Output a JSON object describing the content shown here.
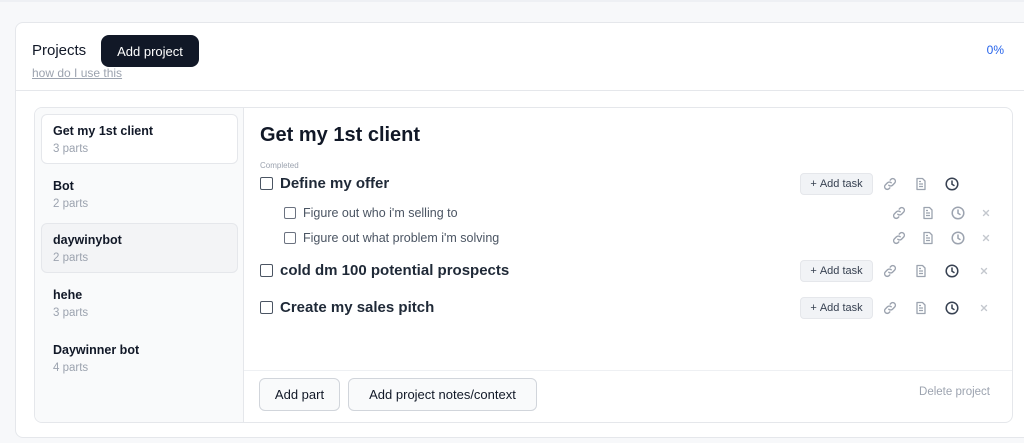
{
  "header": {
    "title": "Projects",
    "add_project_label": "Add project",
    "howto_link": "how do I use this",
    "progress_percent": "0%"
  },
  "sidebar": {
    "items": [
      {
        "name": "Get my 1st client",
        "parts": "3 parts",
        "active": true
      },
      {
        "name": "Bot",
        "parts": "2 parts"
      },
      {
        "name": "daywinybot",
        "parts": "2 parts",
        "hover": true
      },
      {
        "name": "hehe",
        "parts": "3 parts"
      },
      {
        "name": "Daywinner bot",
        "parts": "4 parts"
      }
    ]
  },
  "project": {
    "title": "Get my 1st client",
    "completed_label": "Completed",
    "add_task_label": "Add task",
    "parts": [
      {
        "label": "Define my offer",
        "tasks": [
          {
            "label": "Figure out who i'm selling to"
          },
          {
            "label": "Figure out what problem i'm solving"
          }
        ]
      },
      {
        "label": "cold dm 100 potential prospects",
        "tasks": []
      },
      {
        "label": "Create my sales pitch",
        "tasks": []
      }
    ]
  },
  "footer": {
    "add_part_label": "Add part",
    "add_notes_label": "Add project notes/context",
    "delete_label": "Delete project"
  },
  "colors": {
    "primary_button": "#111827",
    "link_accent": "#2563eb",
    "muted_text": "#9ca3af"
  },
  "icons": [
    "link-icon",
    "document-icon",
    "clock-icon",
    "close-icon",
    "plus-icon"
  ]
}
